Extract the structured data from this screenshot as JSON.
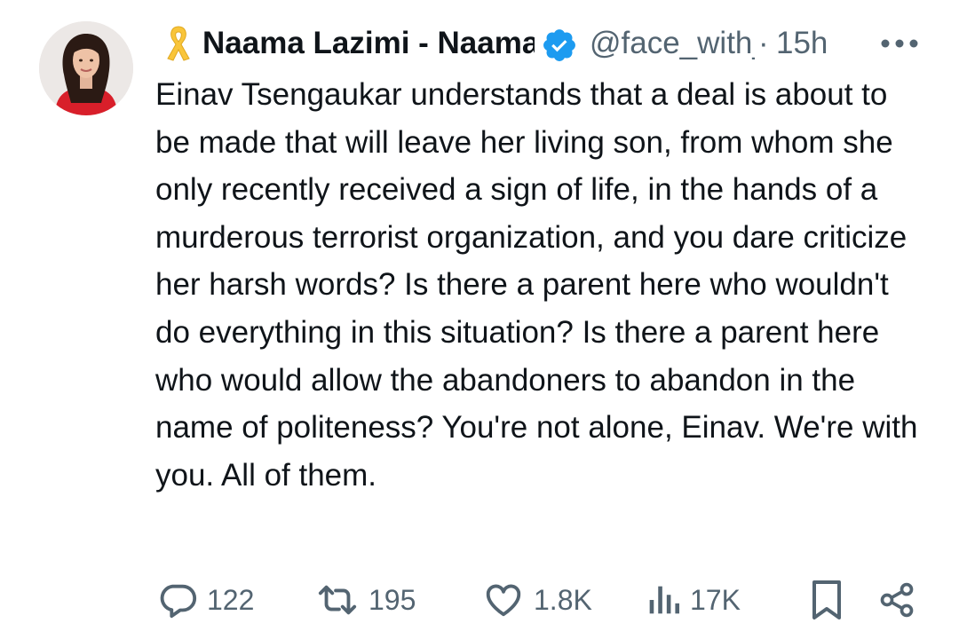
{
  "author": {
    "display_name": "Naama Lazimi - Naama Lazimi",
    "handle": "@face_with_naama",
    "dot": "·",
    "time": "15h"
  },
  "icons": {
    "ribbon": "yellow-ribbon-icon",
    "verified": "verified-badge-icon",
    "more": "more-options-icon",
    "reply": "reply-icon",
    "retweet": "retweet-icon",
    "like": "heart-icon",
    "views": "views-icon",
    "bookmark": "bookmark-icon",
    "share": "share-icon"
  },
  "colors": {
    "verified_blue": "#1d9bf0",
    "ribbon_yellow": "#f9c53a",
    "secondary_text": "#536471"
  },
  "tweet_text": "Einav Tsengaukar understands that a deal is about to be made that will leave her living son, from whom she only recently received a sign of life, in the hands of a murderous terrorist organization, and you dare criticize her harsh words? Is there a parent here who wouldn't do everything in this situation? Is there a parent here who would allow the abandoners to abandon in the name of politeness? You're not alone, Einav. We're with you. All of them.",
  "stats": {
    "replies": "122",
    "retweets": "195",
    "likes": "1.8K",
    "views": "17K"
  }
}
